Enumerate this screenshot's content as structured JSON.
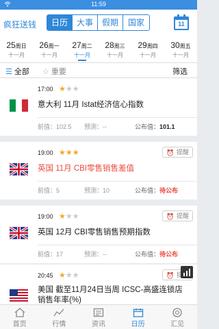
{
  "status_bar": {
    "time": "11:59"
  },
  "header": {
    "brand": "疯狂送钱",
    "tabs": [
      {
        "label": "日历",
        "active": true
      },
      {
        "label": "大事",
        "active": false
      },
      {
        "label": "假期",
        "active": false
      },
      {
        "label": "国家",
        "active": false
      }
    ],
    "calendar_day": "11"
  },
  "dates": [
    {
      "day": "25",
      "weekday": "周日",
      "lunar": "十一月",
      "active": false
    },
    {
      "day": "26",
      "weekday": "周一",
      "lunar": "十一月",
      "active": false
    },
    {
      "day": "27",
      "weekday": "周二",
      "lunar": "十一月",
      "active": true
    },
    {
      "day": "28",
      "weekday": "周三",
      "lunar": "十一月",
      "active": false
    },
    {
      "day": "29",
      "weekday": "周四",
      "lunar": "十一月",
      "active": false
    },
    {
      "day": "30",
      "weekday": "周五",
      "lunar": "十一月",
      "active": false
    }
  ],
  "filter": {
    "all": "全部",
    "important": "重要",
    "filter_btn": "筛选"
  },
  "labels": {
    "prev": "前值：",
    "forecast": "预测：",
    "actual": "公布值：",
    "remind": "提醒"
  },
  "events": [
    {
      "time": "17:00",
      "stars": 1,
      "country": "italy",
      "title": "意大利 11月 Istat经济信心指数",
      "title_red": false,
      "prev": "102.5",
      "forecast": "--",
      "actual": "101.1",
      "pending": false,
      "remind": false
    },
    {
      "time": "19:00",
      "stars": 3,
      "country": "uk",
      "title": "英国 11月 CBI零售销售差值",
      "title_red": true,
      "prev": "5",
      "forecast": "10",
      "actual": "待公布",
      "pending": true,
      "remind": true
    },
    {
      "time": "19:00",
      "stars": 1,
      "country": "uk",
      "title": "英国 12月 CBI零售销售预期指数",
      "title_red": false,
      "prev": "17",
      "forecast": "--",
      "actual": "待公布",
      "pending": true,
      "remind": true
    },
    {
      "time": "20:45",
      "stars": 1,
      "country": "us",
      "title": "美国 截至11月24日当周 ICSC-高盛连锁店销售年率(%)",
      "title_red": false,
      "prev": "",
      "forecast": "",
      "actual": "",
      "pending": true,
      "remind": true
    }
  ],
  "bottom_nav": [
    {
      "label": "首页",
      "icon": "home-icon",
      "active": false
    },
    {
      "label": "行情",
      "icon": "market-icon",
      "active": false
    },
    {
      "label": "资讯",
      "icon": "news-icon",
      "active": false
    },
    {
      "label": "日历",
      "icon": "calendar-icon",
      "active": true
    },
    {
      "label": "汇见",
      "icon": "community-icon",
      "active": false
    }
  ],
  "colors": {
    "accent": "#2f87d8",
    "star": "#f5a623",
    "alert": "#e84b3c"
  }
}
